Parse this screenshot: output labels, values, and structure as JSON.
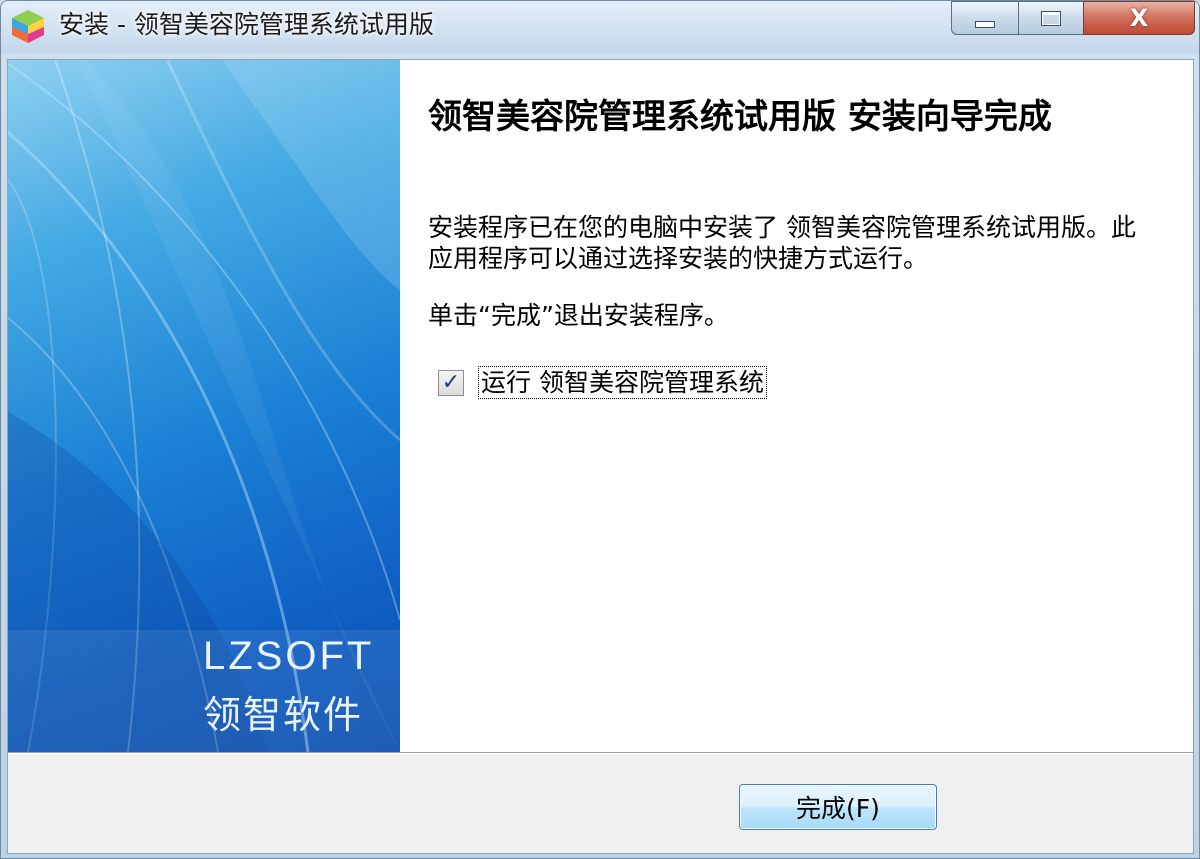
{
  "window": {
    "title": "安装 - 领智美容院管理系统试用版",
    "minimize_icon": "minimize-icon",
    "maximize_icon": "maximize-icon",
    "close_glyph": "X"
  },
  "banner": {
    "brand_en": "LZSOFT",
    "brand_cn": "领智软件"
  },
  "content": {
    "heading": "领智美容院管理系统试用版 安装向导完成",
    "description": "安装程序已在您的电脑中安装了 领智美容院管理系统试用版。此应用程序可以通过选择安装的快捷方式运行。",
    "hint": "单击“完成”退出安装程序。",
    "run_checkbox": {
      "label": "运行 领智美容院管理系统",
      "checked": true,
      "check_glyph": "✓"
    }
  },
  "footer": {
    "finish_label": "完成(F)"
  },
  "colors": {
    "banner_dark": "#0b4eb0",
    "banner_light": "#8fd0f1",
    "close_red": "#c04a35",
    "button_border": "#3c7fb1"
  }
}
